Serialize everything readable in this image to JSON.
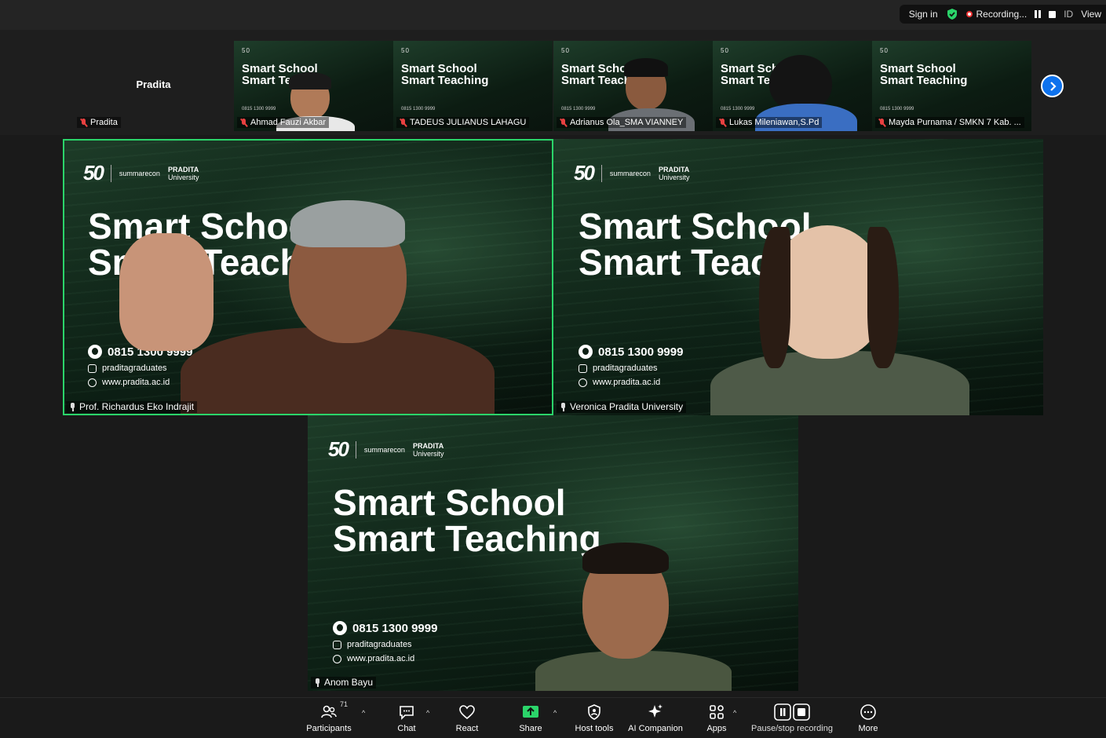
{
  "topbar": {
    "sign_in": "Sign in",
    "recording": "Recording...",
    "id": "ID",
    "view": "View"
  },
  "strip": {
    "tiles": [
      {
        "name": "Pradita",
        "title": "Pradita"
      },
      {
        "name": "Ahmad Fauzi Akbar",
        "line1": "Smart School",
        "line2": "Smart Teaching"
      },
      {
        "name": "TADEUS JULIANUS LAHAGU",
        "line1": "Smart School",
        "line2": "Smart Teaching"
      },
      {
        "name": "Adrianus Ola_SMA VIANNEY",
        "line1": "Smart School",
        "line2": "Smart Teaching"
      },
      {
        "name": "Lukas Mileniawan,S.Pd",
        "line1": "Smart School",
        "line2": "Smart Teaching"
      },
      {
        "name": "Mayda Purnama / SMKN 7 Kab. ...",
        "line1": "Smart School",
        "line2": "Smart Teaching"
      }
    ],
    "thumb_phone": "0815 1300 9999"
  },
  "tiles": {
    "logo_50": "50",
    "logo_summarecon": "summarecon",
    "logo_pradita": "PRADITA",
    "logo_university": "University",
    "line1": "Smart School",
    "line2": "Smart Teaching",
    "phone": "0815 1300 9999",
    "instagram": "praditagraduates",
    "website": "www.pradita.ac.id",
    "speaker1": "Prof. Richardus Eko Indrajit",
    "speaker2": "Veronica Pradita University",
    "speaker3": "Anom Bayu"
  },
  "toolbar": {
    "participants": "Participants",
    "participants_count": "71",
    "chat": "Chat",
    "react": "React",
    "share": "Share",
    "host_tools": "Host tools",
    "ai_companion": "AI Companion",
    "apps": "Apps",
    "pause_stop": "Pause/stop recording",
    "more": "More"
  },
  "colors": {
    "accent_green": "#2bd46a",
    "share_green": "#2bd46a",
    "next_blue": "#0e72ed",
    "muted_red": "#e84040"
  }
}
